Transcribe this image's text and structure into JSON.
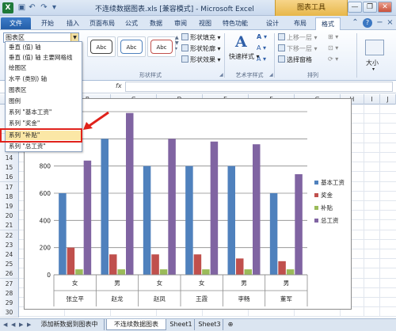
{
  "window": {
    "title": "不连续数据图表.xls  [兼容模式] - Microsoft Excel",
    "chart_tools_label": "图表工具",
    "controls": {
      "minimize": "—",
      "restore": "❐",
      "close": "✕"
    }
  },
  "tabs": [
    {
      "label": "文件"
    },
    {
      "label": "开始"
    },
    {
      "label": "插入"
    },
    {
      "label": "页面布局"
    },
    {
      "label": "公式"
    },
    {
      "label": "数据"
    },
    {
      "label": "审阅"
    },
    {
      "label": "视图"
    },
    {
      "label": "特色功能"
    },
    {
      "label": "设计"
    },
    {
      "label": "布局"
    },
    {
      "label": "格式"
    }
  ],
  "ribbon": {
    "selection_value": "图表区",
    "style_buttons": [
      {
        "label": "Abc"
      },
      {
        "label": "Abc"
      },
      {
        "label": "Abc"
      }
    ],
    "shape_fill": "形状填充",
    "shape_outline": "形状轮廓",
    "shape_effects": "形状效果",
    "shape_styles_group": "形状样式",
    "quick_styles": "快速样式",
    "wordart_group": "艺术字样式",
    "bring_forward": "上移一层",
    "send_backward": "下移一层",
    "selection_pane": "选择窗格",
    "arrange_group": "排列",
    "size": "大小"
  },
  "dropdown": {
    "items": [
      "垂直 (值) 轴",
      "垂直 (值) 轴 主要网格线",
      "绘图区",
      "水平 (类别) 轴",
      "图表区",
      "图例",
      "系列 \"基本工资\"",
      "系列 \"奖金\"",
      "系列 \"补贴\"",
      "系列 \"总工资\""
    ]
  },
  "formula_bar": {
    "fx": "fx",
    "value": ""
  },
  "columns": [
    "A",
    "B",
    "C",
    "D",
    "E",
    "F",
    "G",
    "H",
    "I",
    "J"
  ],
  "rows": [
    "9",
    "10",
    "11",
    "12",
    "13",
    "14",
    "15",
    "16",
    "17",
    "18",
    "19",
    "20",
    "21",
    "22",
    "23",
    "24",
    "25",
    "26",
    "27",
    "28",
    "29",
    "30"
  ],
  "sheets": [
    "添加新数据到图表中",
    "不连续数据图表",
    "Sheet1",
    "Sheet3"
  ],
  "chart_data": {
    "type": "bar",
    "categories": [
      [
        "女",
        "张立平"
      ],
      [
        "男",
        "赵龙"
      ],
      [
        "女",
        "赵凤"
      ],
      [
        "女",
        "王霞"
      ],
      [
        "男",
        "李畅"
      ],
      [
        "男",
        "董军"
      ]
    ],
    "series": [
      {
        "name": "基本工资",
        "color": "#4f81bd",
        "values": [
          600,
          1000,
          800,
          800,
          800,
          600
        ]
      },
      {
        "name": "奖金",
        "color": "#c0504d",
        "values": [
          200,
          150,
          150,
          150,
          120,
          100
        ]
      },
      {
        "name": "补贴",
        "color": "#9bbb59",
        "values": [
          40,
          40,
          40,
          40,
          40,
          40
        ]
      },
      {
        "name": "总工资",
        "color": "#8064a2",
        "values": [
          840,
          1190,
          1000,
          980,
          960,
          740
        ]
      }
    ],
    "yticks": [
      0,
      200,
      400,
      600,
      800,
      1000
    ],
    "ylim": [
      0,
      1200
    ],
    "grid": true,
    "legend_position": "right"
  }
}
